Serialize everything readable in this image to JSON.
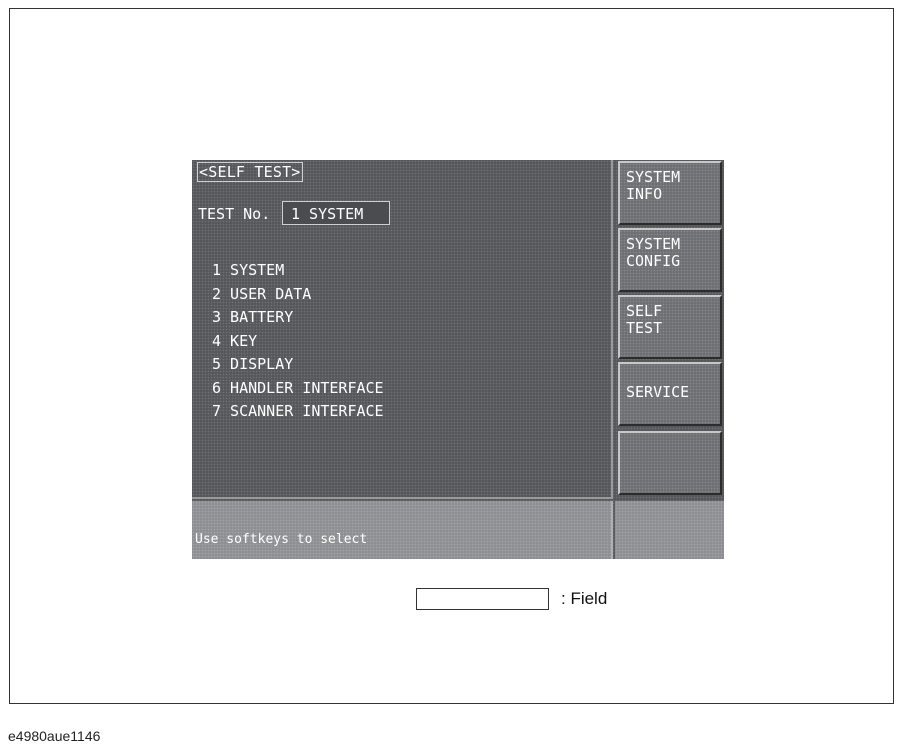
{
  "screen": {
    "title": "<SELF TEST>",
    "test_no_label": "TEST No.",
    "test_no_value": "1 SYSTEM",
    "tests": [
      "1 SYSTEM",
      "2 USER DATA",
      "3 BATTERY",
      "4 KEY",
      "5 DISPLAY",
      "6 HANDLER INTERFACE",
      "7 SCANNER INTERFACE"
    ],
    "message": "Use softkeys to select"
  },
  "softkeys": [
    "SYSTEM\nINFO",
    "SYSTEM\nCONFIG",
    "SELF\nTEST",
    "SERVICE",
    ""
  ],
  "legend": {
    "text": ": Field"
  },
  "figure_id": "e4980aue1146",
  "colors": {
    "screen_bg": "#55575a",
    "text": "#ffffff",
    "softkey_bg": "#6d6f73",
    "message_bar_bg": "#8d8f93"
  }
}
